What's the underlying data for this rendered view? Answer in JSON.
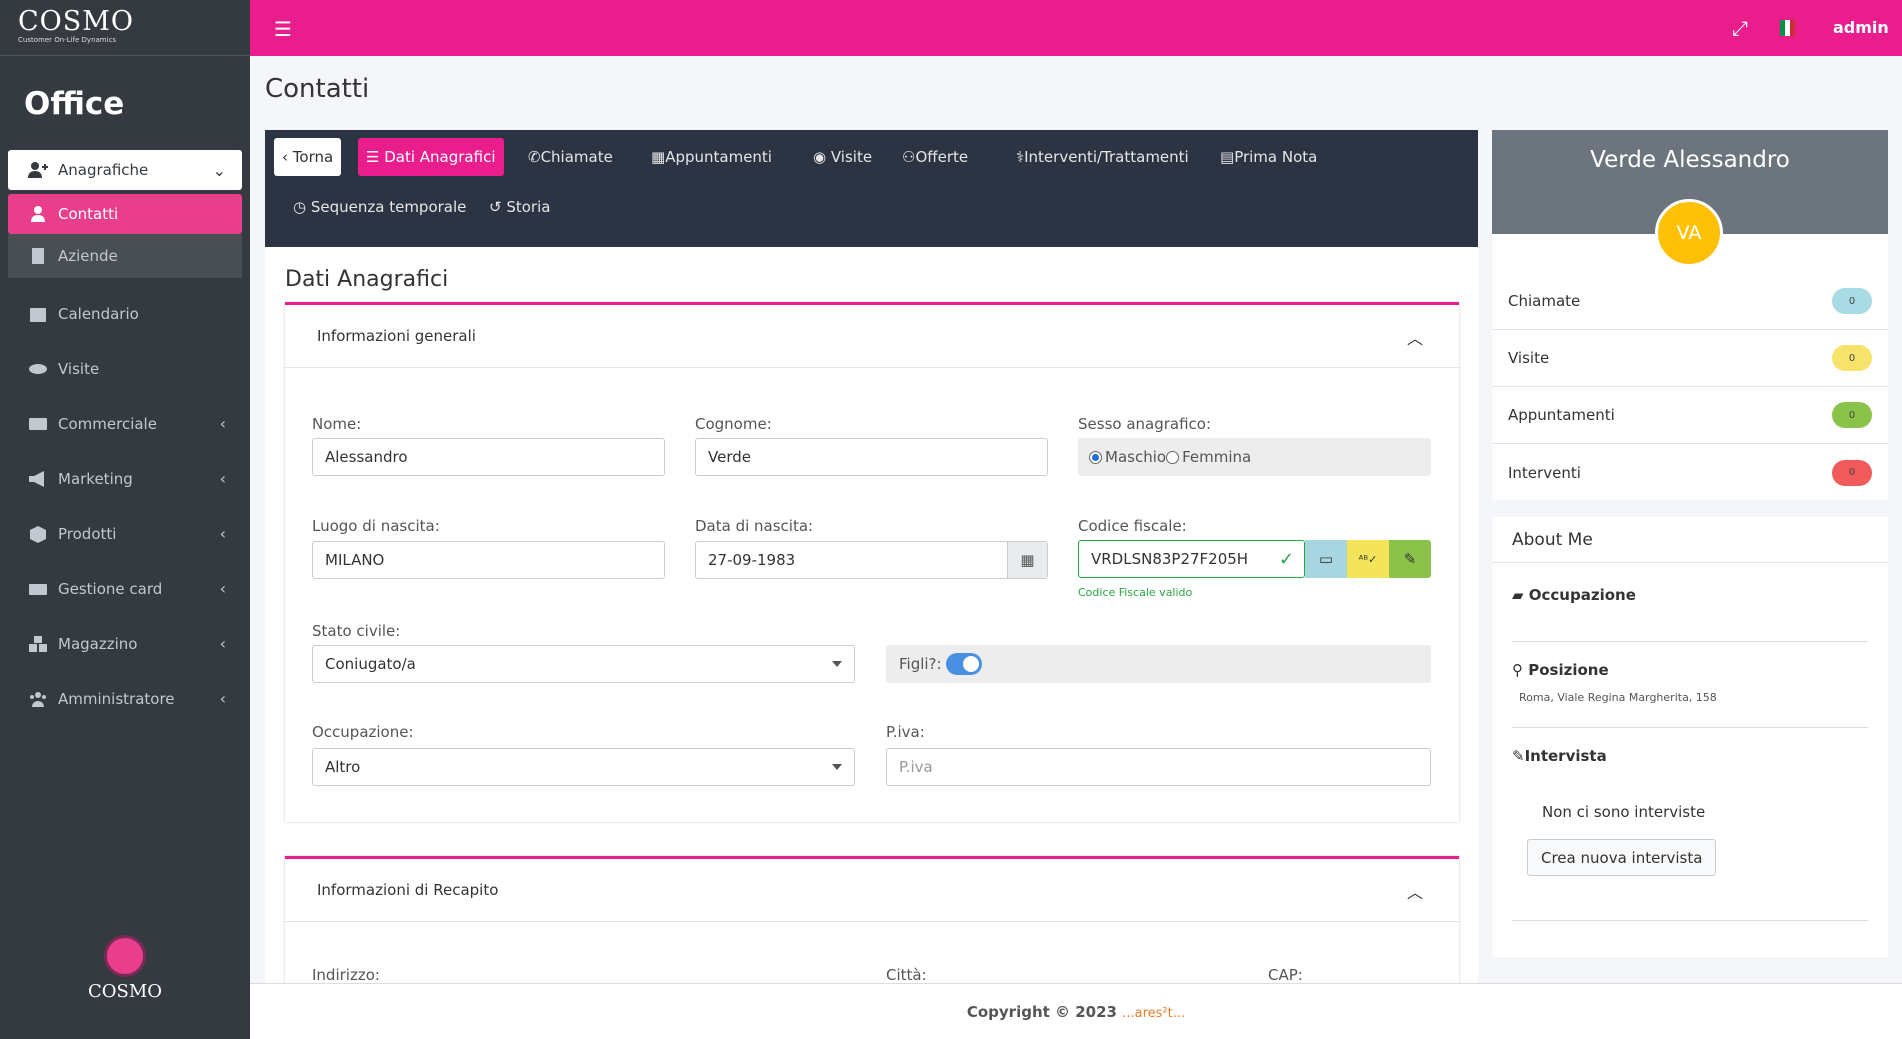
{
  "app": {
    "logo_text": "COSMO",
    "logo_subtitle": "Customer On-Life Dynamics",
    "section_title": "Office",
    "footer_logo": "COSMO"
  },
  "sidebar": {
    "items": [
      {
        "label": "Anagrafiche"
      },
      {
        "label": "Contatti"
      },
      {
        "label": "Aziende"
      },
      {
        "label": "Calendario"
      },
      {
        "label": "Visite"
      },
      {
        "label": "Commerciale"
      },
      {
        "label": "Marketing"
      },
      {
        "label": "Prodotti"
      },
      {
        "label": "Gestione card"
      },
      {
        "label": "Magazzino"
      },
      {
        "label": "Amministratore"
      }
    ]
  },
  "topbar": {
    "user": "admin",
    "flag_colors": [
      "#009246",
      "#ffffff",
      "#ce2b37"
    ]
  },
  "page": {
    "title": "Contatti",
    "section": "Dati Anagrafici"
  },
  "tabs": {
    "back": "Torna",
    "items": [
      "Dati Anagrafici",
      "Chiamate",
      "Appuntamenti",
      "Visite",
      "Offerte",
      "Interventi/Trattamenti",
      "Prima Nota",
      "Sequenza temporale",
      "Storia"
    ]
  },
  "general": {
    "heading": "Informazioni generali",
    "nome_label": "Nome:",
    "nome_value": "Alessandro",
    "cognome_label": "Cognome:",
    "cognome_value": "Verde",
    "sesso_label": "Sesso anagrafico:",
    "sesso_m": "Maschio",
    "sesso_f": "Femmina",
    "luogo_label": "Luogo di nascita:",
    "luogo_value": "MILANO",
    "data_label": "Data di nascita:",
    "data_value": "27-09-1983",
    "cf_label": "Codice fiscale:",
    "cf_value": "VRDLSN83P27F205H",
    "cf_valid": "Codice Fiscale valido",
    "stato_label": "Stato civile:",
    "stato_value": "Coniugato/a",
    "figli_label": "Figli?:",
    "occ_label": "Occupazione:",
    "occ_value": "Altro",
    "piva_label": "P.iva:",
    "piva_placeholder": "P.iva"
  },
  "recapito": {
    "heading": "Informazioni di Recapito",
    "indirizzo_label": "Indirizzo:",
    "citta_label": "Città:",
    "cap_label": "CAP:"
  },
  "profile": {
    "name": "Verde Alessandro",
    "initials": "VA",
    "stats": [
      {
        "label": "Chiamate",
        "count": "0",
        "color": "#a8dbe4"
      },
      {
        "label": "Visite",
        "count": "0",
        "color": "#f7e36b"
      },
      {
        "label": "Appuntamenti",
        "count": "0",
        "color": "#8bc34a"
      },
      {
        "label": "Interventi",
        "count": "0",
        "color": "#f05a5a"
      }
    ]
  },
  "about": {
    "title": "About Me",
    "occupazione": "Occupazione",
    "posizione": "Posizione",
    "posizione_value": "Roma, Viale Regina Margherita, 158",
    "intervista": "Intervista",
    "no_interviste": "Non ci sono interviste",
    "crea_button": "Crea nuova intervista"
  },
  "footer": {
    "copyright": "Copyright © 2023",
    "brand": "...ares²t..."
  }
}
